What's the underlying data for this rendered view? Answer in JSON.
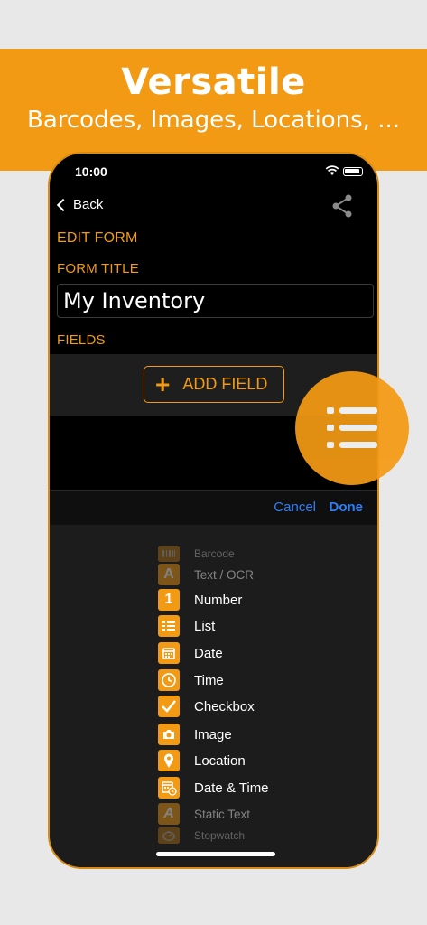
{
  "banner": {
    "title": "Versatile",
    "subtitle": "Barcodes, Images, Locations, ..."
  },
  "status_bar": {
    "time": "10:00"
  },
  "nav": {
    "back_label": "Back"
  },
  "form": {
    "edit_form_label": "EDIT FORM",
    "form_title_label": "FORM TITLE",
    "form_title_value": "My Inventory",
    "fields_label": "FIELDS",
    "add_field_label": "ADD FIELD"
  },
  "picker": {
    "cancel_label": "Cancel",
    "done_label": "Done",
    "items": [
      {
        "label": "Barcode",
        "icon": "barcode-icon"
      },
      {
        "label": "Text / OCR",
        "icon": "text-ocr-icon"
      },
      {
        "label": "Number",
        "icon": "number-icon",
        "glyph": "1"
      },
      {
        "label": "List",
        "icon": "list-icon"
      },
      {
        "label": "Date",
        "icon": "calendar-icon"
      },
      {
        "label": "Time",
        "icon": "clock-icon"
      },
      {
        "label": "Checkbox",
        "icon": "checkmark-icon"
      },
      {
        "label": "Image",
        "icon": "camera-icon"
      },
      {
        "label": "Location",
        "icon": "location-pin-icon"
      },
      {
        "label": "Date & Time",
        "icon": "calendar-clock-icon"
      },
      {
        "label": "Static Text",
        "icon": "static-text-icon"
      },
      {
        "label": "Stopwatch",
        "icon": "stopwatch-icon"
      }
    ]
  },
  "colors": {
    "accent": "#f39a14",
    "link": "#2f7ff7"
  }
}
